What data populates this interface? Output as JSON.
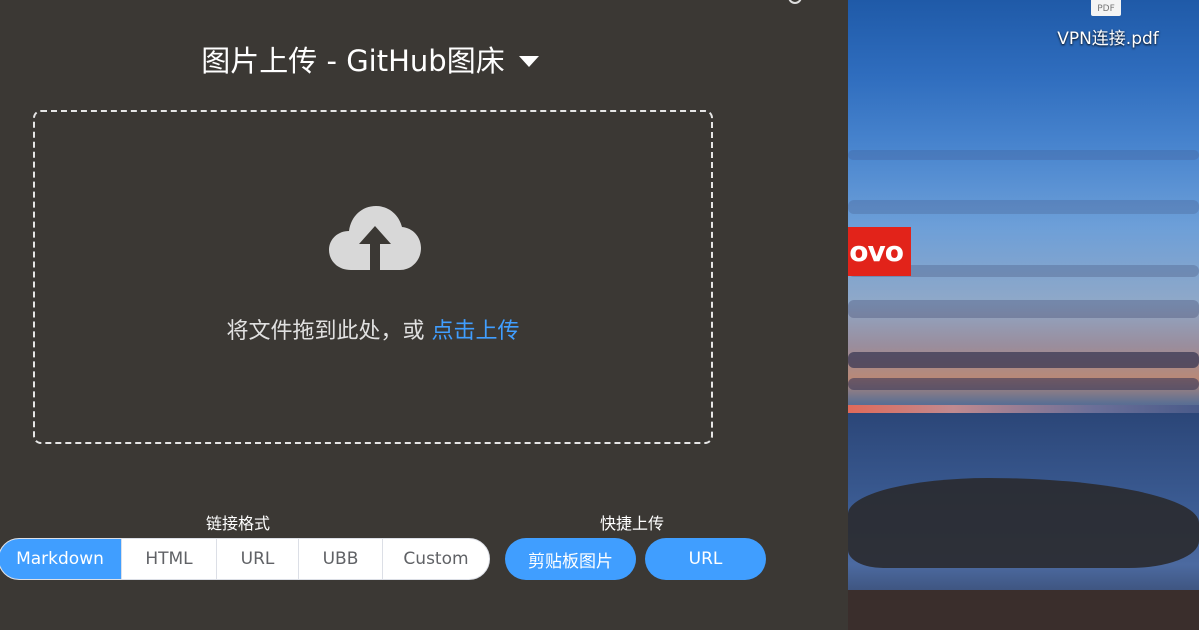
{
  "app": {
    "title": "图片上传 - GitHub图床",
    "dropzone": {
      "text": "将文件拖到此处，或",
      "link": "点击上传",
      "icon": "cloud-upload-icon"
    },
    "link_format": {
      "label": "链接格式",
      "options": [
        "Markdown",
        "HTML",
        "URL",
        "UBB",
        "Custom"
      ],
      "selected": "Markdown"
    },
    "quick_upload": {
      "label": "快捷上传",
      "buttons": [
        "剪贴板图片",
        "URL"
      ]
    },
    "colors": {
      "background": "#3b3834",
      "accent": "#409eff"
    }
  },
  "desktop": {
    "brand_text": "ovo",
    "file": {
      "icon_text": "PDF",
      "name": "VPN连接.pdf"
    }
  }
}
